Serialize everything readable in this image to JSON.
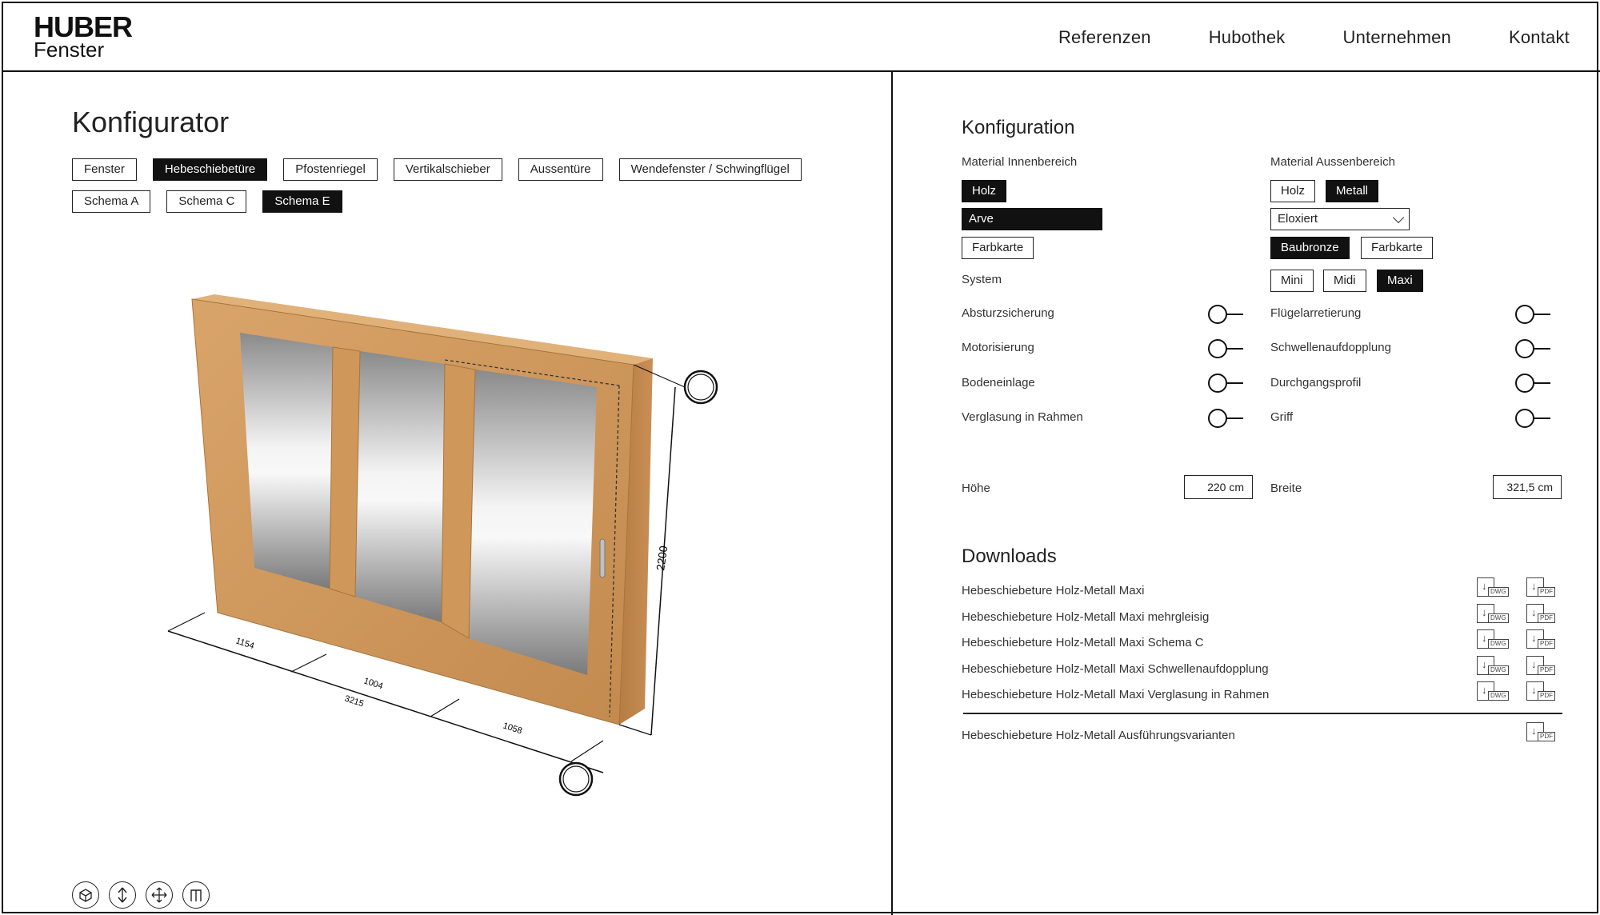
{
  "brand": {
    "line1": "HUBER",
    "line2": "Fenster"
  },
  "nav": [
    {
      "label": "Referenzen"
    },
    {
      "label": "Hubothek"
    },
    {
      "label": "Unternehmen"
    },
    {
      "label": "Kontakt"
    }
  ],
  "konfigurator": {
    "title": "Konfigurator",
    "types": [
      {
        "label": "Fenster",
        "active": false
      },
      {
        "label": "Hebeschiebetüre",
        "active": true
      },
      {
        "label": "Pfostenriegel",
        "active": false
      },
      {
        "label": "Vertikalschieber",
        "active": false
      },
      {
        "label": "Aussentüre",
        "active": false
      },
      {
        "label": "Wendefenster / Schwingflügel",
        "active": false
      }
    ],
    "schemas": [
      {
        "label": "Schema A",
        "active": false
      },
      {
        "label": "Schema C",
        "active": false
      },
      {
        "label": "Schema E",
        "active": true
      }
    ],
    "dimensions": {
      "height": "2200",
      "width_total": "3215",
      "w1": "1154",
      "w2": "1004",
      "w3": "1058"
    },
    "view_controls": [
      "view-3d-icon",
      "vertical-move-icon",
      "pan-move-icon",
      "measure-icon"
    ]
  },
  "konfiguration": {
    "title": "Konfiguration",
    "innen": {
      "label": "Material Innenbereich",
      "material": {
        "label": "Holz",
        "active": true
      },
      "wood": "Arve",
      "color_button": "Farbkarte"
    },
    "aussen": {
      "label": "Material Aussenbereich",
      "materials": [
        {
          "label": "Holz",
          "active": false
        },
        {
          "label": "Metall",
          "active": true
        }
      ],
      "finish": "Eloxiert",
      "colors": [
        {
          "label": "Baubronze",
          "active": true
        },
        {
          "label": "Farbkarte",
          "active": false
        }
      ]
    },
    "system": {
      "label": "System",
      "options": [
        {
          "label": "Mini",
          "active": false
        },
        {
          "label": "Midi",
          "active": false
        },
        {
          "label": "Maxi",
          "active": true
        }
      ]
    },
    "toggles_left": [
      {
        "label": "Absturzsicherung",
        "on": false
      },
      {
        "label": "Motorisierung",
        "on": false
      },
      {
        "label": "Bodeneinlage",
        "on": false
      },
      {
        "label": "Verglasung in Rahmen",
        "on": false
      }
    ],
    "toggles_right": [
      {
        "label": "Flügelarretierung",
        "on": false
      },
      {
        "label": "Schwellenaufdopplung",
        "on": false
      },
      {
        "label": "Durchgangsprofil",
        "on": false
      },
      {
        "label": "Griff",
        "on": false
      }
    ],
    "hoehe": {
      "label": "Höhe",
      "value": "220 cm"
    },
    "breite": {
      "label": "Breite",
      "value": "321,5 cm"
    }
  },
  "downloads": {
    "title": "Downloads",
    "items": [
      {
        "name": "Hebeschiebeture Holz-Metall Maxi",
        "formats": [
          "DWG",
          "PDF"
        ]
      },
      {
        "name": "Hebeschiebeture Holz-Metall Maxi mehrgleisig",
        "formats": [
          "DWG",
          "PDF"
        ]
      },
      {
        "name": "Hebeschiebeture Holz-Metall Maxi Schema C",
        "formats": [
          "DWG",
          "PDF"
        ]
      },
      {
        "name": "Hebeschiebeture Holz-Metall Maxi Schwellenaufdopplung",
        "formats": [
          "DWG",
          "PDF"
        ]
      },
      {
        "name": "Hebeschiebeture Holz-Metall Maxi Verglasung in Rahmen",
        "formats": [
          "DWG",
          "PDF"
        ]
      }
    ],
    "extra": {
      "name": "Hebeschiebeture Holz-Metall Ausführungsvarianten",
      "formats": [
        "PDF"
      ]
    }
  }
}
